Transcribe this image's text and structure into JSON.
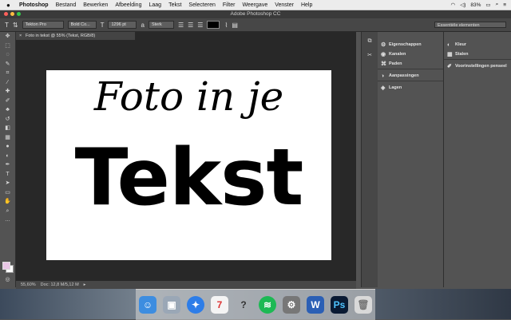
{
  "menubar": {
    "app": "Photoshop",
    "items": [
      "Bestand",
      "Bewerken",
      "Afbeelding",
      "Laag",
      "Tekst",
      "Selecteren",
      "Filter",
      "Weergave",
      "Venster",
      "Help"
    ],
    "battery": "83%"
  },
  "window": {
    "title": "Adobe Photoshop CC"
  },
  "options": {
    "font": "Tekton Pro",
    "style": "Bold Co...",
    "size": "1296 pt",
    "antialias": "Sterk",
    "workspace": "Essentiële elementen"
  },
  "document": {
    "tab": "Foto in tekst @ 55% (Tekst, RGB/8)",
    "line1": "Foto in je",
    "line2": "Tekst"
  },
  "status": {
    "zoom": "55,60%",
    "doc": "Doc: 12,8 M/5,12 M"
  },
  "panels": {
    "col1": [
      "Eigenschappen",
      "Kanalen",
      "Paden",
      "Aanpassingen",
      "Lagen"
    ],
    "col2": [
      "Kleur",
      "Stalen",
      "Voorinstellingen penseel"
    ]
  },
  "colors": {
    "foreground": "#e9c7e6",
    "background": "#ffffff"
  }
}
